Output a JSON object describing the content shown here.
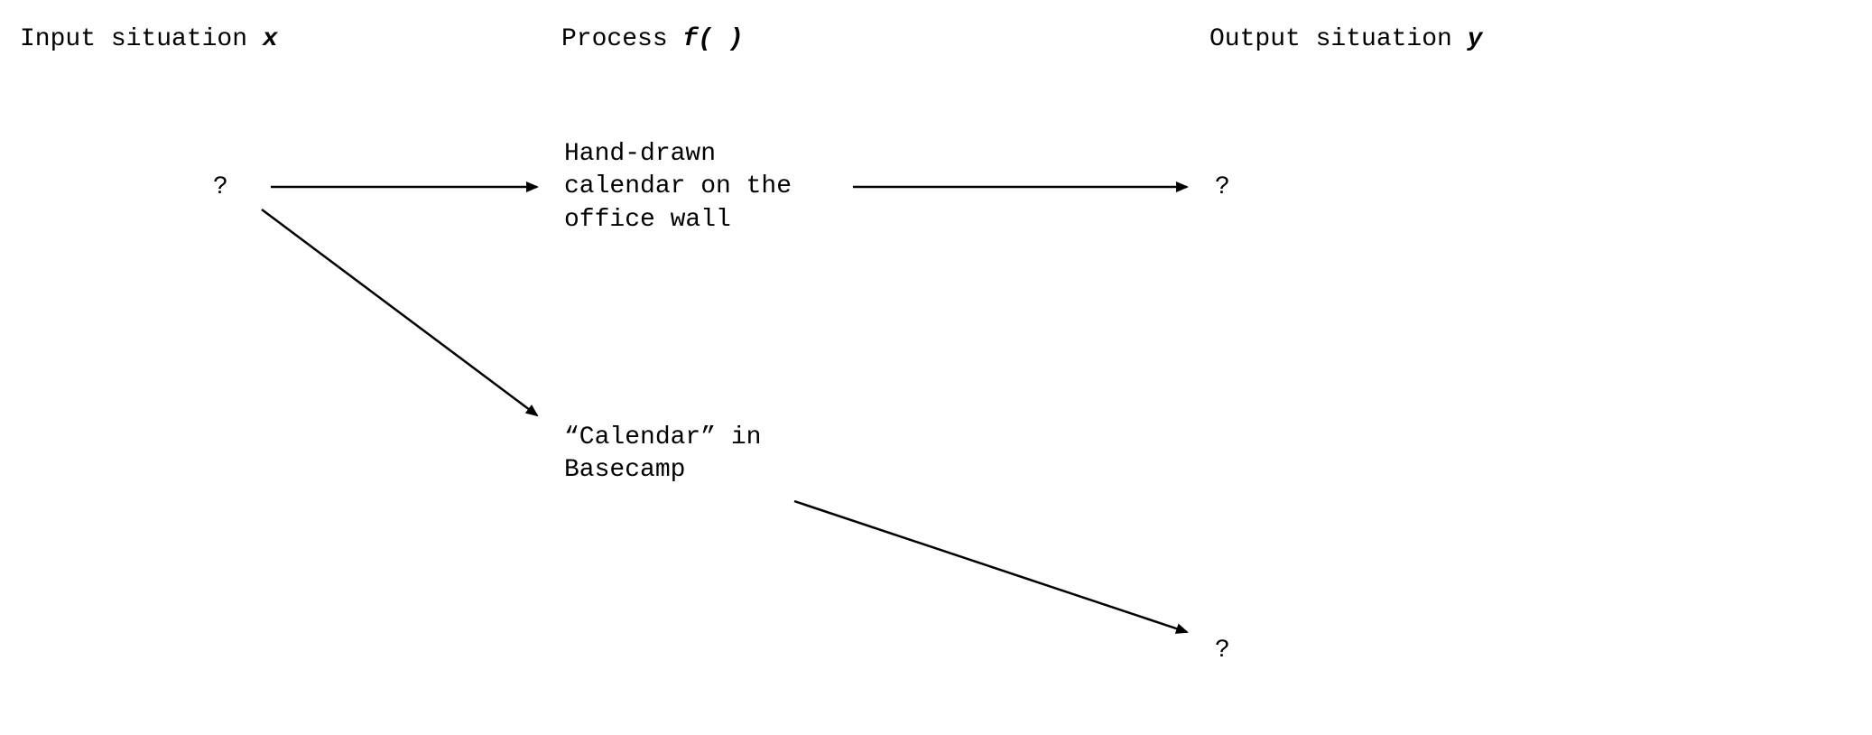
{
  "headers": {
    "input": {
      "text": "Input situation ",
      "var": "x"
    },
    "process": {
      "text": "Process ",
      "var": "f( )"
    },
    "output": {
      "text": "Output situation ",
      "var": "y"
    }
  },
  "nodes": {
    "input_q": "?",
    "process_top": "Hand-drawn\ncalendar on the\noffice wall",
    "process_bottom": "“Calendar”\nin Basecamp",
    "output_top_q": "?",
    "output_bottom_q": "?"
  }
}
